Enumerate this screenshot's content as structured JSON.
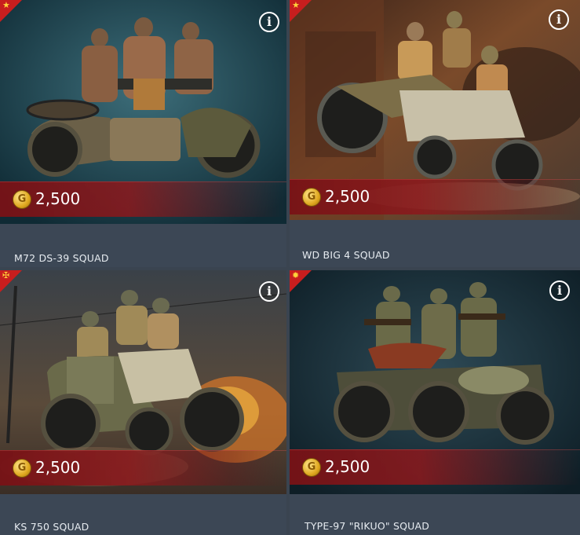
{
  "cards": [
    {
      "name": "M72 DS-39 SQUAD",
      "price": "2,500",
      "currency_icon": "gold-coin-icon",
      "currency_symbol": "G",
      "flag": "ussr-flag-icon",
      "info": "i"
    },
    {
      "name": "WD BIG 4 SQUAD",
      "price": "2,500",
      "currency_icon": "gold-coin-icon",
      "currency_symbol": "G",
      "flag": "ussr-flag-icon",
      "info": "i"
    },
    {
      "name": "KS 750 SQUAD",
      "price": "2,500",
      "currency_icon": "gold-coin-icon",
      "currency_symbol": "G",
      "flag": "germany-flag-icon",
      "info": "i"
    },
    {
      "name": "TYPE-97 \"RIKUO\" SQUAD",
      "price": "2,500",
      "currency_icon": "gold-coin-icon",
      "currency_symbol": "G",
      "flag": "japan-flag-icon",
      "info": "i"
    }
  ],
  "colors": {
    "flag_red": "#c81e1e",
    "price_band": "#8c181c",
    "gold": "#e0a820"
  }
}
